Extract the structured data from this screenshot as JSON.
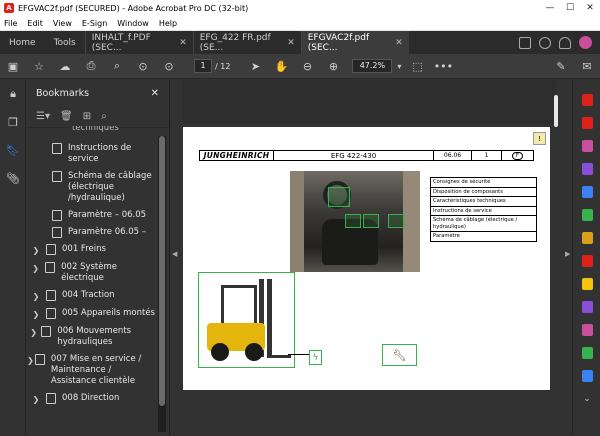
{
  "window": {
    "title": "EFGVAC2f.pdf (SECURED) - Adobe Acrobat Pro DC (32-bit)",
    "minimize": "—",
    "maximize": "☐",
    "close": "✕"
  },
  "menu": [
    "File",
    "Edit",
    "View",
    "E-Sign",
    "Window",
    "Help"
  ],
  "tabs": {
    "home": "Home",
    "tools": "Tools",
    "docs": [
      {
        "label": "INHALT_f.PDF (SEC...",
        "active": false
      },
      {
        "label": "EFG_422 FR.pdf (SE...",
        "active": false
      },
      {
        "label": "EFGVAC2f.pdf (SEC...",
        "active": true
      }
    ]
  },
  "toolbar": {
    "current_page": "1",
    "total_pages": "/ 12",
    "zoom": "47.2%"
  },
  "bookmarks": {
    "title": "Bookmarks",
    "items": [
      {
        "label": "techniques",
        "has_children": false,
        "partial": true
      },
      {
        "label": "Instructions de service",
        "has_children": false
      },
      {
        "label": "Schéma de câblage (électrique /hydraulique)",
        "has_children": false
      },
      {
        "label": "Paramètre – 06.05",
        "has_children": false
      },
      {
        "label": "Paramètre 06.05 –",
        "has_children": false
      },
      {
        "label": "001 Freins",
        "has_children": true
      },
      {
        "label": "002 Système électrique",
        "has_children": true
      },
      {
        "label": "004 Traction",
        "has_children": true
      },
      {
        "label": "005 Appareils montés",
        "has_children": true
      },
      {
        "label": "006 Mouvements hydrauliques",
        "has_children": true
      },
      {
        "label": "007 Mise en service / Maintenance / Assistance clientèle",
        "has_children": true
      },
      {
        "label": "008 Direction",
        "has_children": true
      }
    ]
  },
  "document": {
    "header": {
      "brand": "JUNGHEINRICH",
      "model": "EFG 422-430",
      "date": "06.06",
      "page": "1",
      "lang": "F"
    },
    "contents_list": [
      "Consignes de sécurité",
      "Disposition de composants",
      "Caractéristiques techniques",
      "Instructions de service",
      "Schéma de câblage (électrique / hydraulique)",
      "Paramètre"
    ]
  },
  "colors": {
    "accent": "#2d8ceb",
    "highlight_green": "#37b24d",
    "truck_yellow": "#e3b50d"
  }
}
